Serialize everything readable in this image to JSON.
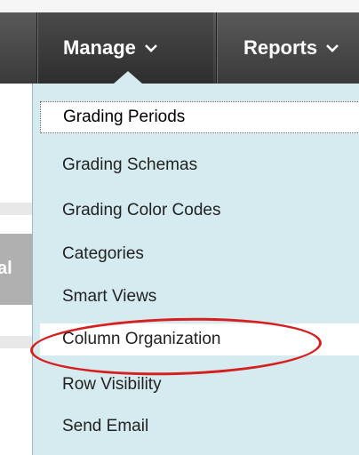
{
  "nav": {
    "manage_label": "Manage",
    "reports_label": "Reports"
  },
  "menu": {
    "items": [
      {
        "label": "Grading Periods",
        "state": "focused"
      },
      {
        "label": "Grading Schemas"
      },
      {
        "label": "Grading Color Codes"
      },
      {
        "label": "Categories"
      },
      {
        "label": "Smart Views"
      },
      {
        "label": "Column Organization",
        "state": "highlighted",
        "annotated": true
      },
      {
        "label": "Row Visibility"
      },
      {
        "label": "Send Email"
      }
    ]
  },
  "background": {
    "partial_tab_text": "al"
  },
  "colors": {
    "nav_bg": "#3a3a3a",
    "menu_bg": "#d6ebf0",
    "annotation": "#d62020"
  },
  "icons": {
    "manage_chevron": "chevron-down-icon",
    "reports_chevron": "chevron-down-icon"
  }
}
